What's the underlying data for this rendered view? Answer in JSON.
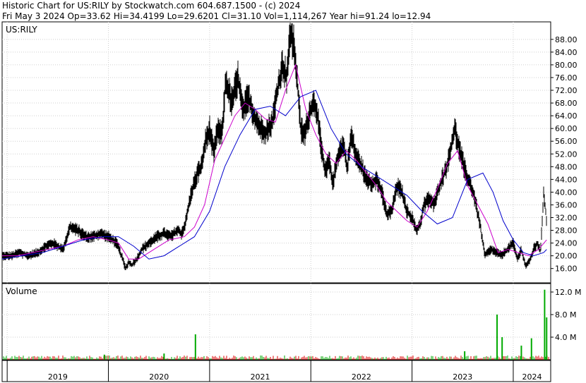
{
  "header": {
    "line1": "Historic Chart for US:RILY by Stockwatch.com 604.687.1500 - (c) 2024",
    "line2": "Fri May  3 2024   Op=33.62  Hi=34.4199  Lo=29.6201  Cl=31.10  Vol=1,114,267  Year hi=91.24  lo=12.94"
  },
  "price_panel": {
    "label": "US:RILY"
  },
  "volume_panel": {
    "label": "Volume"
  },
  "chart_data": {
    "type": "line",
    "symbol": "US:RILY",
    "title": "Historic Chart for US:RILY by Stockwatch.com 604.687.1500 - (c) 2024",
    "price_axis": {
      "ylim": [
        11.5,
        93.5
      ],
      "ticks": [
        16,
        20,
        24,
        28,
        32,
        36,
        40,
        44,
        48,
        52,
        56,
        60,
        64,
        68,
        72,
        76,
        80,
        84,
        88
      ],
      "tick_labels": [
        "16.00",
        "20.00",
        "24.00",
        "28.00",
        "32.00",
        "36.00",
        "40.00",
        "44.00",
        "48.00",
        "52.00",
        "56.00",
        "60.00",
        "64.00",
        "68.00",
        "72.00",
        "76.00",
        "80.00",
        "84.00",
        "88.00"
      ]
    },
    "volume_axis": {
      "ylim": [
        0,
        13500000
      ],
      "ticks": [
        4000000,
        8000000,
        12000000
      ],
      "tick_labels": [
        "4.0 M",
        "8.0 M",
        "12.0 M"
      ]
    },
    "x_axis": {
      "years": [
        "2019",
        "2020",
        "2021",
        "2022",
        "2023",
        "2024"
      ],
      "year_start": [
        2019,
        2020,
        2021,
        2022,
        2023,
        2024
      ],
      "xlim": [
        2018.95,
        2024.37
      ],
      "grid": true
    },
    "series": [
      {
        "color": "#000000",
        "x": [
          2018.95,
          2019.05,
          2019.12,
          2019.2,
          2019.3,
          2019.38,
          2019.45,
          2019.55,
          2019.62,
          2019.7,
          2019.78,
          2019.85,
          2019.92,
          2020.0,
          2020.08,
          2020.13,
          2020.17,
          2020.2,
          2020.23,
          2020.28,
          2020.33,
          2020.4,
          2020.48,
          2020.55,
          2020.62,
          2020.68,
          2020.72,
          2020.76,
          2020.82,
          2020.88,
          2020.92,
          2020.96,
          2021.0,
          2021.04,
          2021.08,
          2021.12,
          2021.16,
          2021.22,
          2021.28,
          2021.33,
          2021.38,
          2021.44,
          2021.5,
          2021.56,
          2021.62,
          2021.66,
          2021.72,
          2021.76,
          2021.8,
          2021.84,
          2021.87,
          2021.9,
          2021.94,
          2021.98,
          2022.02,
          2022.06,
          2022.1,
          2022.14,
          2022.18,
          2022.22,
          2022.27,
          2022.32,
          2022.36,
          2022.4,
          2022.44,
          2022.5,
          2022.55,
          2022.6,
          2022.65,
          2022.7,
          2022.75,
          2022.8,
          2022.85,
          2022.9,
          2022.95,
          2023.0,
          2023.04,
          2023.08,
          2023.12,
          2023.17,
          2023.22,
          2023.27,
          2023.32,
          2023.36,
          2023.42,
          2023.48,
          2023.53,
          2023.58,
          2023.62,
          2023.67,
          2023.72,
          2023.78,
          2023.84,
          2023.88,
          2023.94,
          2024.0,
          2024.04,
          2024.08,
          2024.12,
          2024.16,
          2024.2,
          2024.24,
          2024.27,
          2024.3,
          2024.33
        ],
        "values": [
          20,
          20,
          21,
          20,
          21,
          23,
          24,
          22,
          29,
          28,
          26,
          26,
          27,
          26,
          24,
          20,
          16,
          18,
          17,
          19,
          22,
          24,
          26,
          27,
          26,
          28,
          27,
          30,
          40,
          46,
          48,
          56,
          60,
          52,
          60,
          58,
          75,
          68,
          76,
          65,
          70,
          64,
          60,
          59,
          62,
          70,
          80,
          76,
          90,
          85,
          73,
          60,
          58,
          64,
          68,
          66,
          55,
          46,
          50,
          43,
          52,
          55,
          48,
          58,
          52,
          48,
          44,
          43,
          44,
          40,
          33,
          34,
          42,
          40,
          34,
          32,
          28,
          30,
          36,
          38,
          36,
          42,
          46,
          50,
          60,
          52,
          46,
          42,
          38,
          30,
          20,
          22,
          21,
          20,
          22,
          24,
          19,
          22,
          17,
          18,
          22,
          24,
          21,
          40,
          31
        ]
      },
      {
        "name": "",
        "color": "#cc00cc",
        "x": [
          2018.95,
          2019.1,
          2019.25,
          2019.4,
          2019.55,
          2019.7,
          2019.85,
          2020.0,
          2020.1,
          2020.2,
          2020.3,
          2020.45,
          2020.6,
          2020.75,
          2020.85,
          2020.95,
          2021.05,
          2021.15,
          2021.25,
          2021.35,
          2021.45,
          2021.55,
          2021.65,
          2021.75,
          2021.85,
          2021.95,
          2022.05,
          2022.15,
          2022.25,
          2022.35,
          2022.45,
          2022.55,
          2022.65,
          2022.75,
          2022.85,
          2022.95,
          2023.05,
          2023.15,
          2023.25,
          2023.35,
          2023.45,
          2023.55,
          2023.65,
          2023.75,
          2023.85,
          2023.95,
          2024.05,
          2024.15,
          2024.25,
          2024.33
        ],
        "values": [
          20,
          20,
          21,
          22,
          23,
          25,
          26,
          25,
          24,
          19,
          19,
          22,
          25,
          26,
          29,
          36,
          50,
          57,
          64,
          68,
          66,
          63,
          62,
          72,
          80,
          66,
          58,
          52,
          49,
          53,
          50,
          46,
          42,
          37,
          34,
          31,
          29,
          34,
          41,
          49,
          53,
          42,
          36,
          30,
          21,
          22,
          21,
          20,
          22,
          25
        ]
      },
      {
        "name": "",
        "color": "#0000cc",
        "x": [
          2018.95,
          2019.15,
          2019.35,
          2019.55,
          2019.75,
          2019.95,
          2020.1,
          2020.25,
          2020.4,
          2020.55,
          2020.7,
          2020.85,
          2021.0,
          2021.15,
          2021.3,
          2021.45,
          2021.6,
          2021.75,
          2021.9,
          2022.05,
          2022.2,
          2022.35,
          2022.5,
          2022.65,
          2022.8,
          2022.95,
          2023.1,
          2023.25,
          2023.4,
          2023.55,
          2023.7,
          2023.8,
          2023.9,
          2024.0,
          2024.1,
          2024.2,
          2024.3,
          2024.33
        ],
        "values": [
          19,
          20,
          21,
          23,
          25,
          26,
          26,
          23,
          19,
          20,
          23,
          26,
          34,
          48,
          58,
          66,
          67,
          64,
          70,
          72,
          60,
          52,
          48,
          45,
          42,
          39,
          34,
          30,
          32,
          44,
          46,
          40,
          31,
          25,
          21,
          20,
          21,
          22
        ]
      }
    ],
    "volume": {
      "bar_color_down": "#dd0000",
      "bar_color_up": "#00aa00",
      "spikes": [
        {
          "x": 2019.96,
          "value": 900000
        },
        {
          "x": 2020.55,
          "value": 1100000
        },
        {
          "x": 2020.86,
          "value": 4500000
        },
        {
          "x": 2023.52,
          "value": 1500000
        },
        {
          "x": 2023.84,
          "value": 8000000
        },
        {
          "x": 2023.89,
          "value": 4000000
        },
        {
          "x": 2024.08,
          "value": 2500000
        },
        {
          "x": 2024.18,
          "value": 3800000
        },
        {
          "x": 2024.31,
          "value": 12400000
        },
        {
          "x": 2024.33,
          "value": 7500000
        }
      ]
    }
  }
}
